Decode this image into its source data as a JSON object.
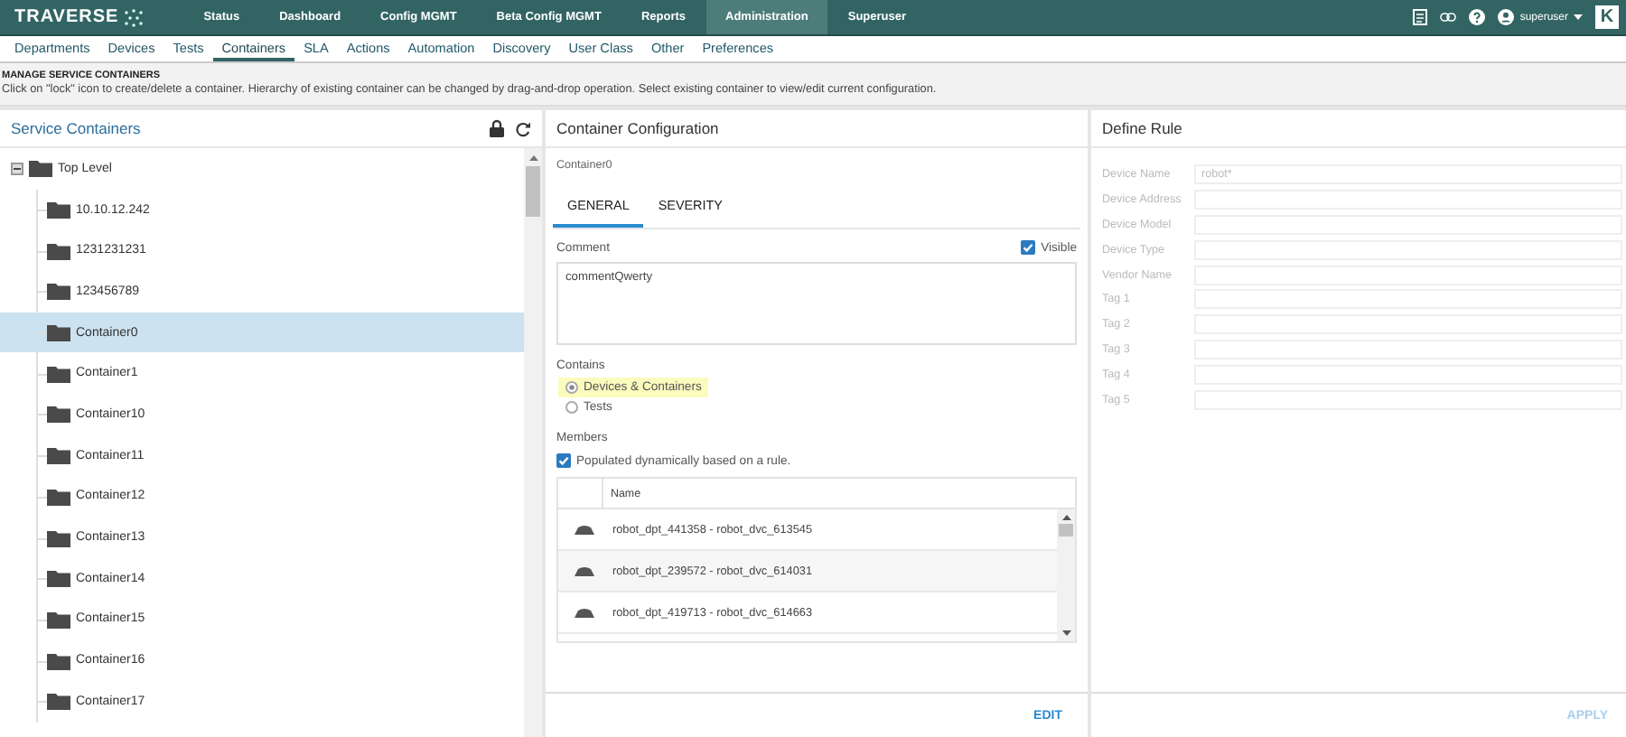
{
  "topbar": {
    "logo": "TRAVERSE",
    "nav": [
      {
        "label": "Status",
        "selected": false
      },
      {
        "label": "Dashboard",
        "selected": false
      },
      {
        "label": "Config MGMT",
        "selected": false
      },
      {
        "label": "Beta Config MGMT",
        "selected": false
      },
      {
        "label": "Reports",
        "selected": false
      },
      {
        "label": "Administration",
        "selected": true
      },
      {
        "label": "Superuser",
        "selected": false
      }
    ],
    "user": "superuser",
    "badge": "K"
  },
  "subnav": [
    {
      "label": "Departments",
      "selected": false
    },
    {
      "label": "Devices",
      "selected": false
    },
    {
      "label": "Tests",
      "selected": false
    },
    {
      "label": "Containers",
      "selected": true
    },
    {
      "label": "SLA",
      "selected": false
    },
    {
      "label": "Actions",
      "selected": false
    },
    {
      "label": "Automation",
      "selected": false
    },
    {
      "label": "Discovery",
      "selected": false
    },
    {
      "label": "User Class",
      "selected": false
    },
    {
      "label": "Other",
      "selected": false
    },
    {
      "label": "Preferences",
      "selected": false
    }
  ],
  "page_header": {
    "title": "MANAGE SERVICE CONTAINERS",
    "description": "Click on \"lock\" icon to create/delete a container. Hierarchy of existing container can be changed by drag-and-drop operation. Select existing container to view/edit current configuration."
  },
  "tree_panel": {
    "title": "Service Containers",
    "root": {
      "label": "Top Level",
      "expanded": true,
      "selected": false,
      "children": [
        {
          "label": "10.10.12.242",
          "selected": false
        },
        {
          "label": "1231231231",
          "selected": false
        },
        {
          "label": "123456789",
          "selected": false
        },
        {
          "label": "Container0",
          "selected": true
        },
        {
          "label": "Container1",
          "selected": false
        },
        {
          "label": "Container10",
          "selected": false
        },
        {
          "label": "Container11",
          "selected": false
        },
        {
          "label": "Container12",
          "selected": false
        },
        {
          "label": "Container13",
          "selected": false
        },
        {
          "label": "Container14",
          "selected": false
        },
        {
          "label": "Container15",
          "selected": false
        },
        {
          "label": "Container16",
          "selected": false
        },
        {
          "label": "Container17",
          "selected": false
        }
      ]
    }
  },
  "config_panel": {
    "title": "Container Configuration",
    "container_name": "Container0",
    "tabs": [
      {
        "label": "GENERAL",
        "selected": true
      },
      {
        "label": "SEVERITY",
        "selected": false
      }
    ],
    "comment_label": "Comment",
    "visible": {
      "label": "Visible",
      "checked": true
    },
    "comment": "commentQwerty",
    "contains_label": "Contains",
    "contains_options": [
      {
        "label": "Devices & Containers",
        "selected": true
      },
      {
        "label": "Tests",
        "selected": false
      }
    ],
    "members_label": "Members",
    "dynamic": {
      "label": "Populated dynamically based on a rule.",
      "checked": true
    },
    "members_table": {
      "columns": [
        "Name"
      ],
      "rows": [
        {
          "name": "robot_dpt_441358 - robot_dvc_613545"
        },
        {
          "name": "robot_dpt_239572 - robot_dvc_614031"
        },
        {
          "name": "robot_dpt_419713 - robot_dvc_614663"
        }
      ]
    },
    "edit_button": "EDIT"
  },
  "rule_panel": {
    "title": "Define Rule",
    "fields": [
      {
        "label": "Device Name",
        "value": "robot*"
      },
      {
        "label": "Device Address"
      },
      {
        "label": "Device Model"
      },
      {
        "label": "Device Type"
      },
      {
        "label": "Vendor Name"
      },
      {
        "label": "Tag 1"
      },
      {
        "label": "Tag 2"
      },
      {
        "label": "Tag 3"
      },
      {
        "label": "Tag 4"
      },
      {
        "label": "Tag 5"
      }
    ],
    "apply_button": "APPLY",
    "apply_disabled": true
  }
}
